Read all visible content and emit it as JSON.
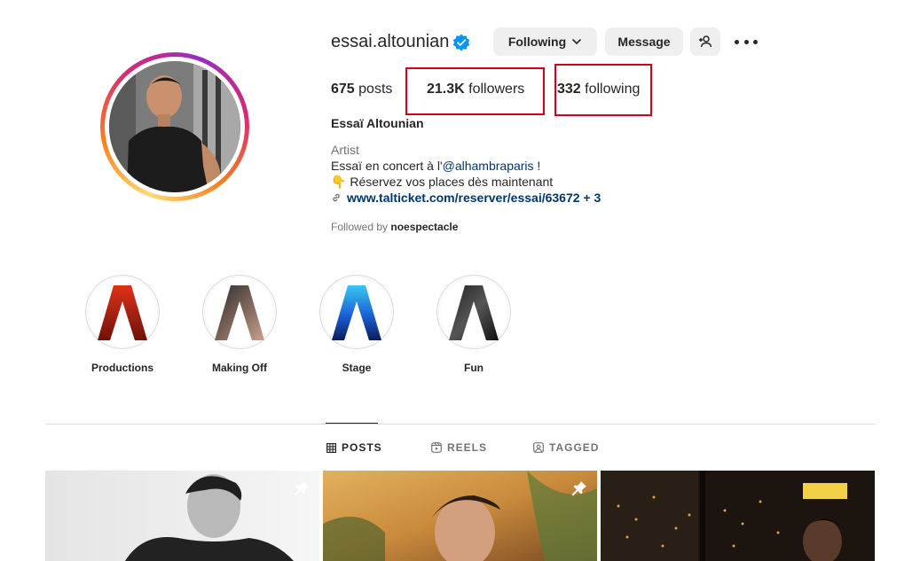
{
  "profile": {
    "username": "essai.altounian",
    "verified": true,
    "full_name": "Essaï Altounian",
    "category": "Artist",
    "bio_line1_prefix": "Essaï en concert à l'",
    "bio_mention": "@alhambraparis",
    "bio_line1_suffix": " !",
    "bio_line2_emoji": "👇",
    "bio_line2_text": "Réservez vos places dès maintenant",
    "link": "www.talticket.com/reserver/essai/63672 + 3",
    "followed_by_prefix": "Followed by ",
    "followed_by_user": "noespectacle"
  },
  "buttons": {
    "following": "Following",
    "message": "Message"
  },
  "stats": {
    "posts_count": "675",
    "posts_label": " posts",
    "followers_count": "21.3K",
    "followers_label": " followers",
    "following_count": "332",
    "following_label": " following"
  },
  "highlights": [
    {
      "label": "Productions"
    },
    {
      "label": "Making Off"
    },
    {
      "label": "Stage"
    },
    {
      "label": "Fun"
    }
  ],
  "tabs": [
    {
      "label": "POSTS",
      "icon": "grid-icon",
      "active": true
    },
    {
      "label": "REELS",
      "icon": "reels-icon",
      "active": false
    },
    {
      "label": "TAGGED",
      "icon": "tagged-icon",
      "active": false
    }
  ],
  "colors": {
    "verified": "#0095f6",
    "highlight_box": "#d0021b",
    "link": "#00376b"
  }
}
